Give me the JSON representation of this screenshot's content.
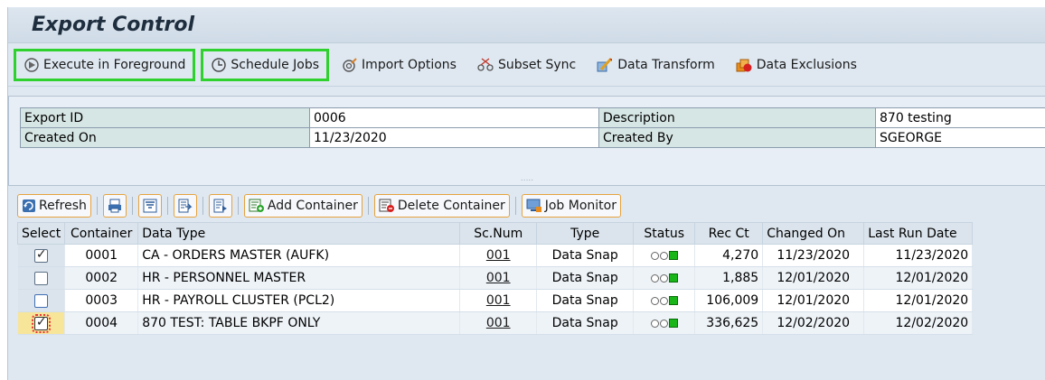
{
  "title": "Export Control",
  "toolbar": [
    {
      "label": "Execute in Foreground",
      "icon": "execute-icon"
    },
    {
      "label": "Schedule Jobs",
      "icon": "clock-icon"
    },
    {
      "label": "Import Options",
      "icon": "import-icon"
    },
    {
      "label": "Subset Sync",
      "icon": "sync-icon"
    },
    {
      "label": "Data Transform",
      "icon": "transform-icon"
    },
    {
      "label": "Data Exclusions",
      "icon": "exclusion-icon"
    }
  ],
  "header": {
    "export_id_label": "Export ID",
    "export_id": "0006",
    "description_label": "Description",
    "description": "870 testing",
    "created_on_label": "Created On",
    "created_on": "11/23/2020",
    "created_by_label": "Created By",
    "created_by": "SGEORGE"
  },
  "alv_toolbar": {
    "refresh": "Refresh",
    "add_container": "Add Container",
    "delete_container": "Delete Container",
    "job_monitor": "Job Monitor"
  },
  "columns": {
    "select": "Select",
    "container": "Container",
    "data_type": "Data Type",
    "sc_num": "Sc.Num",
    "type": "Type",
    "status": "Status",
    "rec_ct": "Rec Ct",
    "changed_on": "Changed On",
    "last_run_date": "Last Run Date"
  },
  "rows": [
    {
      "checked": true,
      "container": "0001",
      "data_type": "CA - ORDERS MASTER (AUFK)",
      "sc_num": "001",
      "type": "Data Snap",
      "rec_ct": "4,270",
      "changed_on": "11/23/2020",
      "last_run_date": "11/23/2020"
    },
    {
      "checked": false,
      "container": "0002",
      "data_type": "HR - PERSONNEL MASTER",
      "sc_num": "001",
      "type": "Data Snap",
      "rec_ct": "1,885",
      "changed_on": "12/01/2020",
      "last_run_date": "12/01/2020"
    },
    {
      "checked": false,
      "container": "0003",
      "data_type": "HR - PAYROLL CLUSTER (PCL2)",
      "sc_num": "001",
      "type": "Data Snap",
      "rec_ct": "106,009",
      "changed_on": "12/01/2020",
      "last_run_date": "12/01/2020"
    },
    {
      "checked": true,
      "container": "0004",
      "data_type": "870 TEST: TABLE BKPF ONLY",
      "sc_num": "001",
      "type": "Data Snap",
      "rec_ct": "336,625",
      "changed_on": "12/02/2020",
      "last_run_date": "12/02/2020"
    }
  ],
  "colors": {
    "highlight_border": "#2ed12e",
    "status_green": "#19b519",
    "label_cell": "#d6e6e4"
  }
}
